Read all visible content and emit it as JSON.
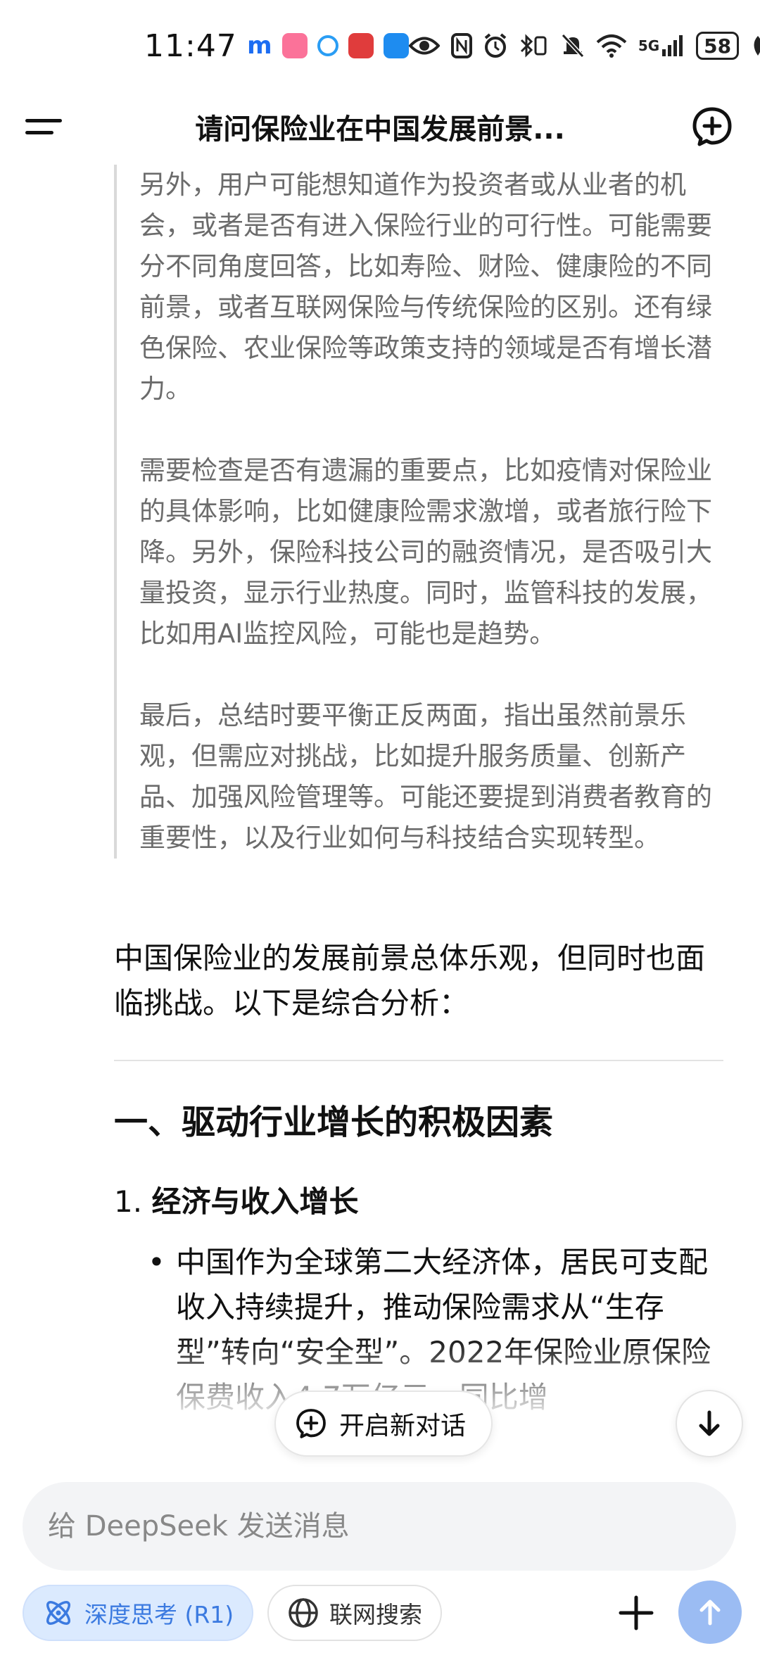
{
  "status_bar": {
    "time": "11:47",
    "network": "5G",
    "battery": "58"
  },
  "header": {
    "title": "请问保险业在中国发展前景..."
  },
  "thinking": {
    "paragraphs": [
      "另外，用户可能想知道作为投资者或从业者的机会，或者是否有进入保险行业的可行性。可能需要分不同角度回答，比如寿险、财险、健康险的不同前景，或者互联网保险与传统保险的区别。还有绿色保险、农业保险等政策支持的领域是否有增长潜力。",
      "需要检查是否有遗漏的重要点，比如疫情对保险业的具体影响，比如健康险需求激增，或者旅行险下降。另外，保险科技公司的融资情况，是否吸引大量投资，显示行业热度。同时，监管科技的发展，比如用AI监控风险，可能也是趋势。",
      "最后，总结时要平衡正反两面，指出虽然前景乐观，但需应对挑战，比如提升服务质量、创新产品、加强风险管理等。可能还要提到消费者教育的重要性，以及行业如何与科技结合实现转型。"
    ]
  },
  "answer": {
    "intro": "中国保险业的发展前景总体乐观，但同时也面临挑战。以下是综合分析：",
    "section_title": "一、驱动行业增长的积极因素",
    "item_number": "1.",
    "item_title": "经济与收入增长",
    "bullet": "中国作为全球第二大经济体，居民可支配收入持续提升，推动保险需求从“生存型”转向“安全型”。2022年保险业原保险保费收入4.7万亿元，同比增"
  },
  "floating": {
    "new_chat_label": "开启新对话"
  },
  "input": {
    "placeholder": "给 DeepSeek 发送消息"
  },
  "toolbar": {
    "deep_think_label": "深度思考 (R1)",
    "web_search_label": "联网搜索"
  },
  "colors": {
    "accent": "#3b7ae0",
    "send_button": "#9bbcf3",
    "thinking_text": "#6b6b6b"
  }
}
